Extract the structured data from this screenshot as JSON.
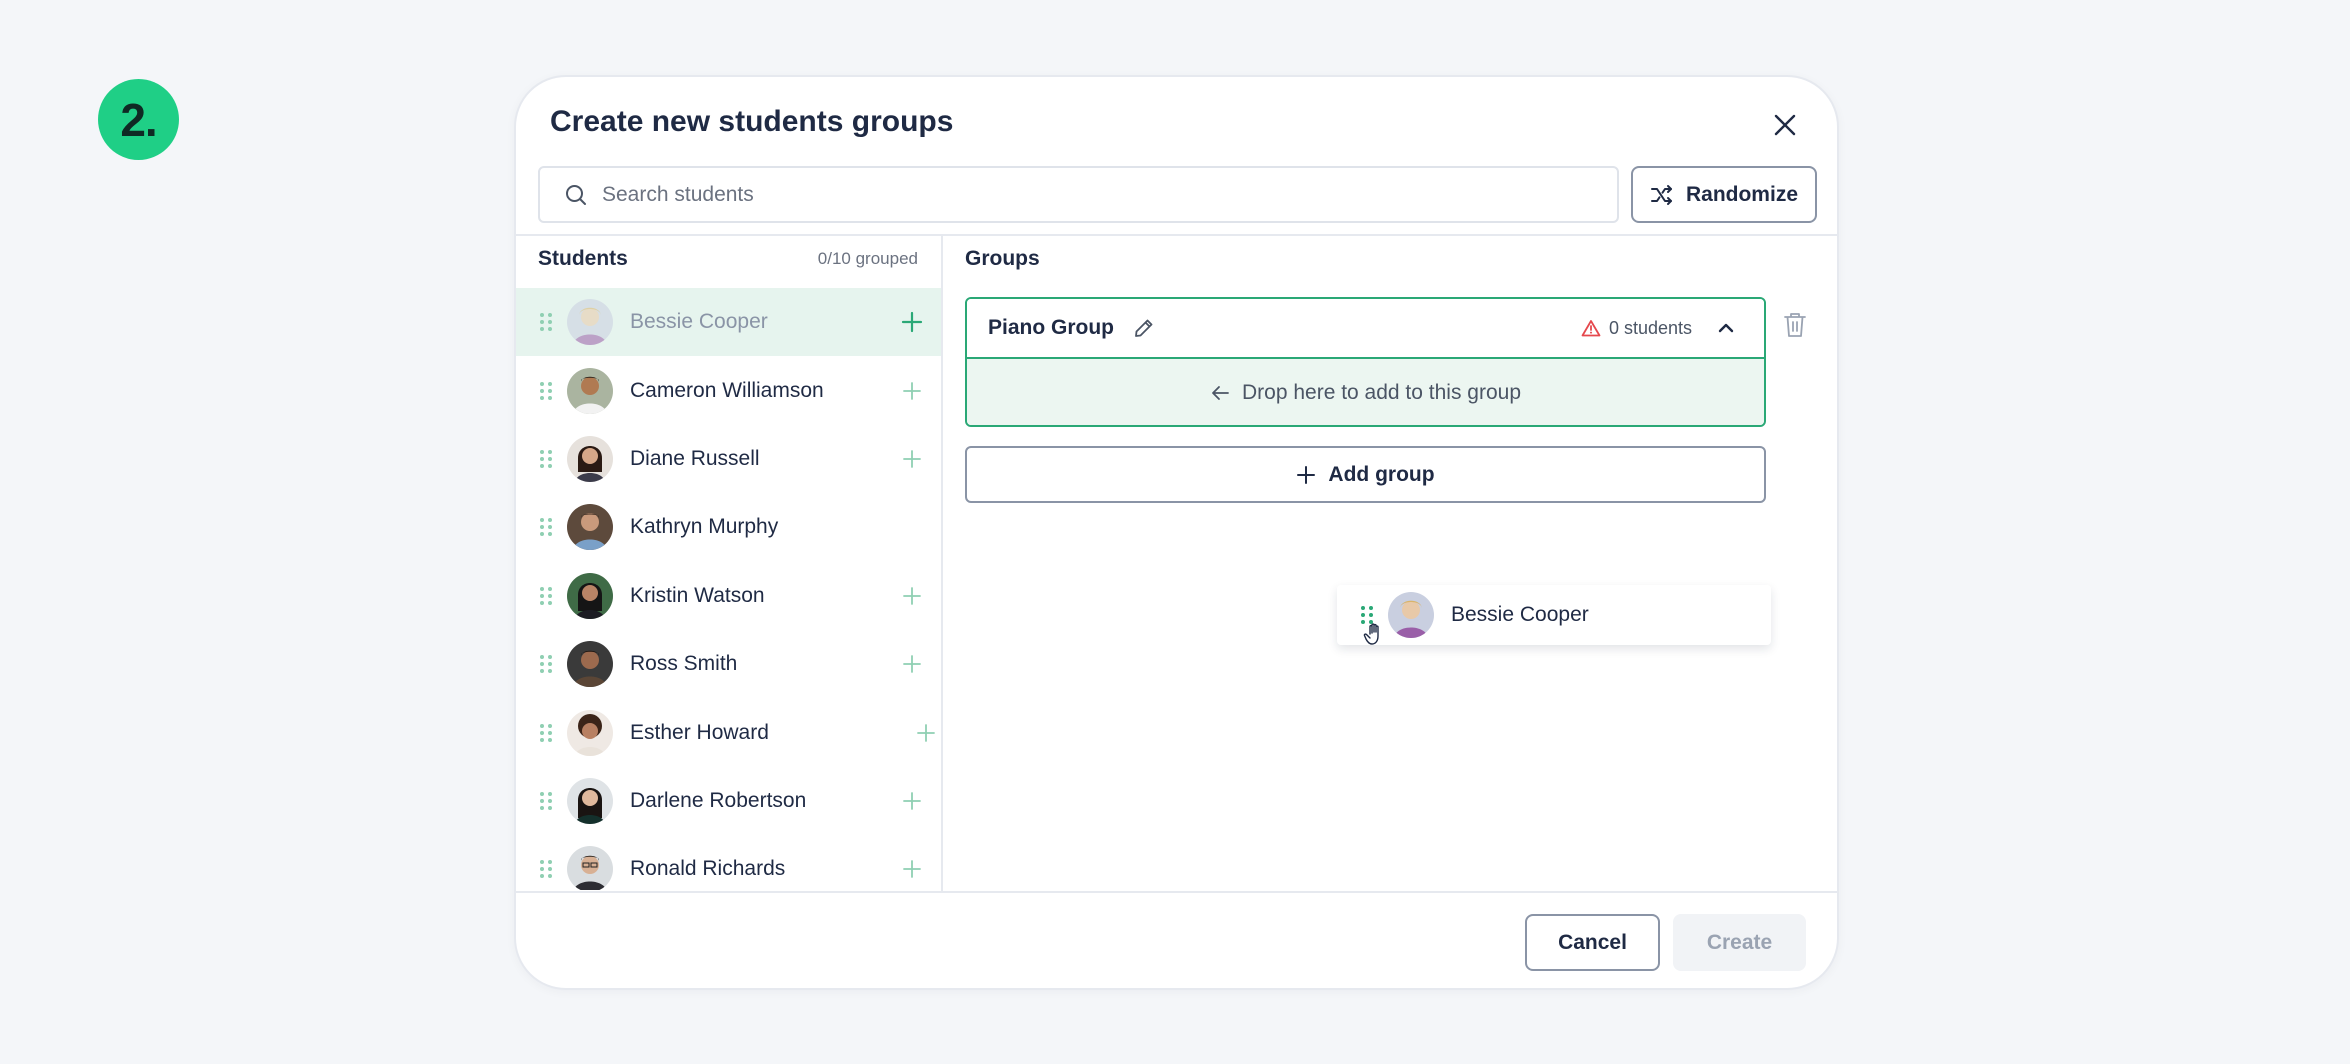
{
  "step": {
    "label": "2."
  },
  "modal": {
    "title": "Create new students groups"
  },
  "search": {
    "placeholder": "Search students",
    "value": ""
  },
  "toolbar": {
    "randomize_label": "Randomize"
  },
  "students": {
    "title": "Students",
    "grouped_count": "0/10 grouped",
    "items": [
      {
        "name": "Bessie Cooper",
        "state": "dragging"
      },
      {
        "name": "Cameron Williamson"
      },
      {
        "name": "Diane Russell"
      },
      {
        "name": "Kathryn Murphy"
      },
      {
        "name": "Kristin Watson"
      },
      {
        "name": "Ross Smith"
      },
      {
        "name": "Esther Howard"
      },
      {
        "name": "Darlene Robertson"
      },
      {
        "name": "Ronald Richards"
      }
    ]
  },
  "groups": {
    "title": "Groups",
    "items": [
      {
        "name": "Piano Group",
        "count_label": "0 students",
        "drop_hint": "Drop here to add to this group"
      }
    ],
    "add_group_label": "Add group"
  },
  "drag_ghost": {
    "name": "Bessie Cooper"
  },
  "footer": {
    "cancel_label": "Cancel",
    "create_label": "Create"
  },
  "colors": {
    "accent": "#2aa876",
    "badge": "#1fcf86",
    "warning": "#e5484d",
    "drag_highlight": "#e6f4ee"
  },
  "icons": {
    "search": "search-icon",
    "close": "close-icon",
    "randomize": "shuffle-icon",
    "edit": "pencil-icon",
    "warning": "warning-triangle-icon",
    "collapse": "chevron-up-icon",
    "trash": "trash-icon",
    "plus": "plus-icon",
    "arrow": "arrow-left-icon",
    "drag": "drag-handle-icon",
    "cursor": "grab-hand-cursor-icon"
  }
}
